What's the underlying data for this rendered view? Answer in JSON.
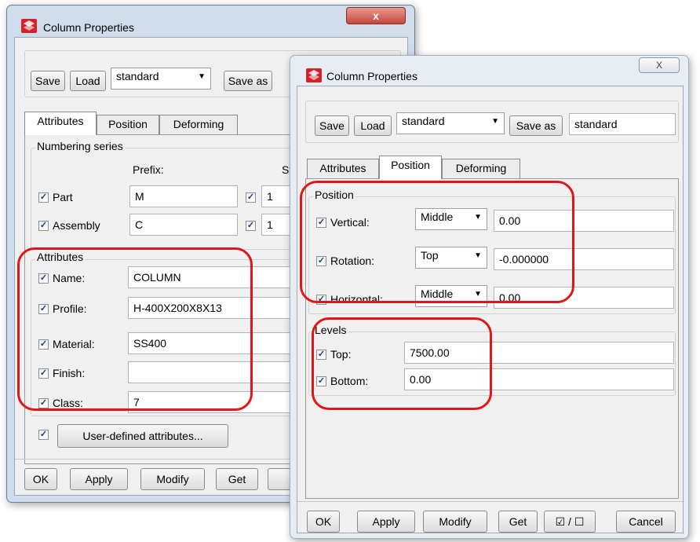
{
  "back_window": {
    "title": "Column Properties",
    "close_label": "x",
    "toolbar": {
      "save_label": "Save",
      "load_label": "Load",
      "preset": "standard",
      "save_as_label": "Save as"
    },
    "tabs": [
      "Attributes",
      "Position",
      "Deforming"
    ],
    "numbering": {
      "group_label": "Numbering series",
      "prefix_header": "Prefix:",
      "start_header": "Start",
      "part_label": "Part",
      "part_prefix": "M",
      "part_start": "1",
      "assembly_label": "Assembly",
      "assembly_prefix": "C",
      "assembly_start": "1"
    },
    "attributes": {
      "group_label": "Attributes",
      "name_label": "Name:",
      "name_value": "COLUMN",
      "profile_label": "Profile:",
      "profile_value": "H-400X200X8X13",
      "material_label": "Material:",
      "material_value": "SS400",
      "finish_label": "Finish:",
      "finish_value": "",
      "class_label": "Class:",
      "class_value": "7"
    },
    "user_defined_label": "User-defined attributes...",
    "footer": {
      "ok": "OK",
      "apply": "Apply",
      "modify": "Modify",
      "get": "Get"
    }
  },
  "front_window": {
    "title": "Column Properties",
    "close_label": "X",
    "toolbar": {
      "save_label": "Save",
      "load_label": "Load",
      "preset": "standard",
      "save_as_label": "Save as",
      "save_as_value": "standard"
    },
    "tabs": [
      "Attributes",
      "Position",
      "Deforming"
    ],
    "position": {
      "group_label": "Position",
      "vertical_label": "Vertical:",
      "vertical_option": "Middle",
      "vertical_value": "0.00",
      "rotation_label": "Rotation:",
      "rotation_option": "Top",
      "rotation_value": "-0.000000",
      "horizontal_label": "Horizontal:",
      "horizontal_option": "Middle",
      "horizontal_value": "0.00"
    },
    "levels": {
      "group_label": "Levels",
      "top_label": "Top:",
      "top_value": "7500.00",
      "bottom_label": "Bottom:",
      "bottom_value": "0.00"
    },
    "footer": {
      "ok": "OK",
      "apply": "Apply",
      "modify": "Modify",
      "get": "Get",
      "toggle": "☑ / ☐",
      "cancel": "Cancel"
    }
  },
  "check_mark": "✓",
  "dropdown_arrow": "▼",
  "colors": {
    "highlight": "#e0171a",
    "window_frame": "#cfdcec",
    "client_bg": "#f0f0f0",
    "close_red": "#c8463c"
  }
}
